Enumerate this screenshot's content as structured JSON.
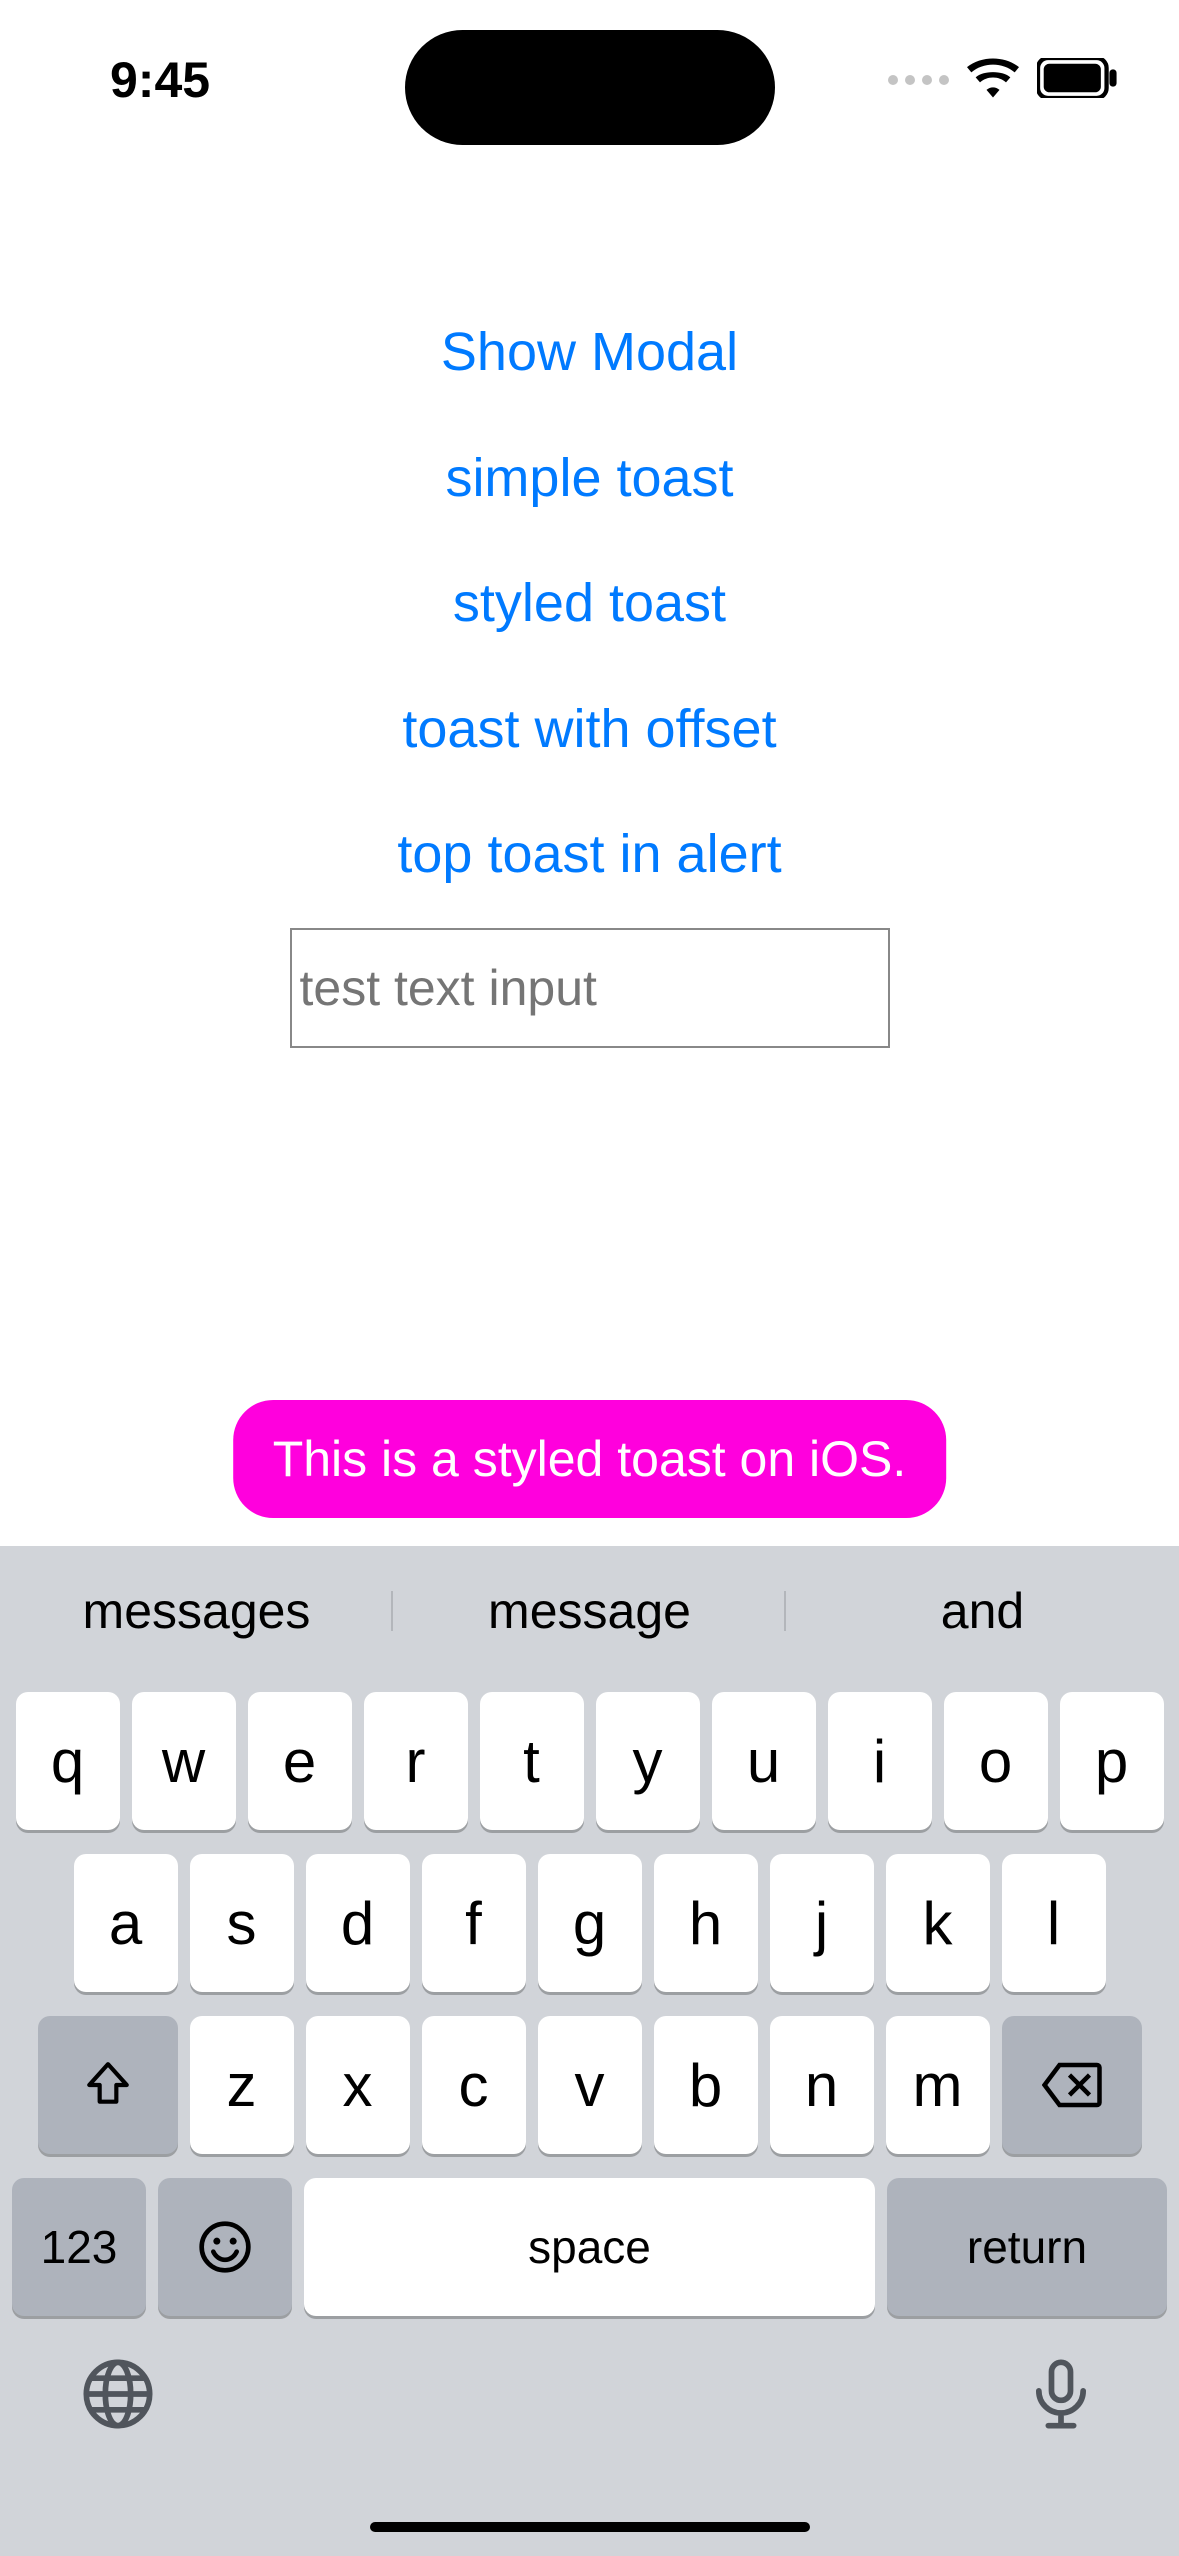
{
  "status": {
    "time": "9:45"
  },
  "links": {
    "show_modal": "Show Modal",
    "simple_toast": "simple toast",
    "styled_toast": "styled toast",
    "toast_offset": "toast with offset",
    "top_toast": "top toast in alert"
  },
  "input": {
    "placeholder": "test text input"
  },
  "toast": {
    "message": "This is a styled toast on iOS."
  },
  "keyboard": {
    "suggestions": [
      "messages",
      "message",
      "and"
    ],
    "row1": [
      "q",
      "w",
      "e",
      "r",
      "t",
      "y",
      "u",
      "i",
      "o",
      "p"
    ],
    "row2": [
      "a",
      "s",
      "d",
      "f",
      "g",
      "h",
      "j",
      "k",
      "l"
    ],
    "row3": [
      "z",
      "x",
      "c",
      "v",
      "b",
      "n",
      "m"
    ],
    "num_label": "123",
    "space_label": "space",
    "return_label": "return"
  }
}
